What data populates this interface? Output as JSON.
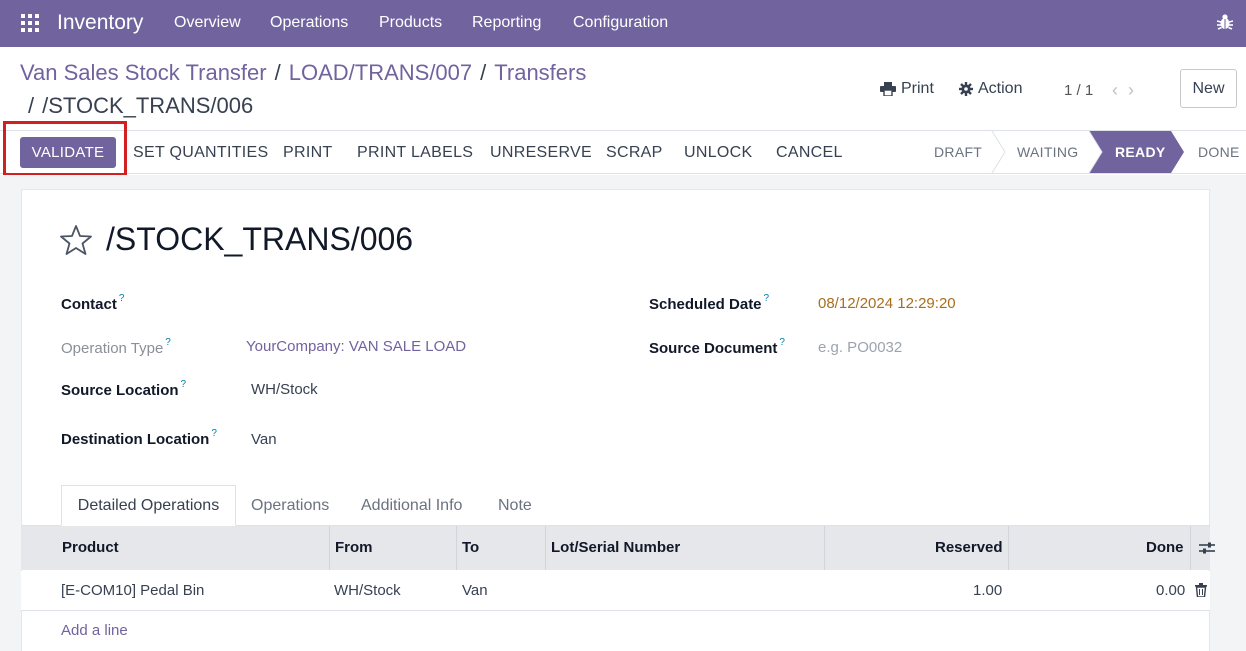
{
  "navbar": {
    "app_name": "Inventory",
    "menu": [
      "Overview",
      "Operations",
      "Products",
      "Reporting",
      "Configuration"
    ]
  },
  "control_panel": {
    "breadcrumb": [
      "Van Sales Stock Transfer",
      "LOAD/TRANS/007",
      "Transfers"
    ],
    "breadcrumb_current": "/STOCK_TRANS/006",
    "print_label": "Print",
    "action_label": "Action",
    "pager": "1 / 1",
    "new_label": "New"
  },
  "statusbar": {
    "buttons": [
      "VALIDATE",
      "SET QUANTITIES",
      "PRINT",
      "PRINT LABELS",
      "UNRESERVE",
      "SCRAP",
      "UNLOCK",
      "CANCEL"
    ],
    "stages": [
      "DRAFT",
      "WAITING",
      "READY",
      "DONE"
    ],
    "active_stage": "READY"
  },
  "record": {
    "title": "/STOCK_TRANS/006",
    "fields": {
      "contact_label": "Contact",
      "operation_type_label": "Operation Type",
      "operation_type_value": "YourCompany: VAN SALE LOAD",
      "source_location_label": "Source Location",
      "source_location_value": "WH/Stock",
      "destination_location_label": "Destination Location",
      "destination_location_value": "Van",
      "scheduled_date_label": "Scheduled Date",
      "scheduled_date_value": "08/12/2024 12:29:20",
      "source_document_label": "Source Document",
      "source_document_placeholder": "e.g. PO0032",
      "help_marker": "?"
    }
  },
  "tabs": [
    "Detailed Operations",
    "Operations",
    "Additional Info",
    "Note"
  ],
  "table": {
    "headers": [
      "Product",
      "From",
      "To",
      "Lot/Serial Number",
      "Reserved",
      "Done"
    ],
    "rows": [
      [
        "[E-COM10] Pedal Bin",
        "WH/Stock",
        "Van",
        "",
        "1.00",
        "0.00"
      ]
    ],
    "add_line": "Add a line"
  },
  "colors": {
    "brand": "#71639e",
    "highlight": "#d21f1f",
    "date": "#a86e1f"
  }
}
